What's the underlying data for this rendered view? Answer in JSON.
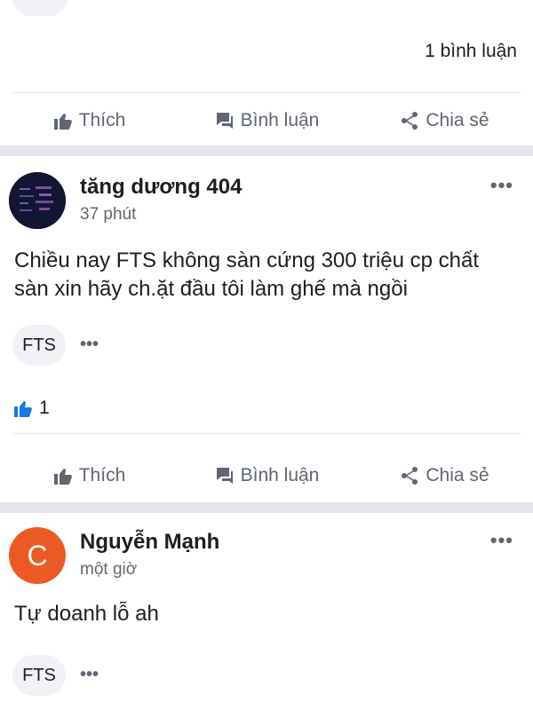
{
  "post1": {
    "comment_count": "1 bình luận"
  },
  "actions": {
    "like": "Thích",
    "comment": "Bình luận",
    "share": "Chia sẻ"
  },
  "post2": {
    "author": "tăng dương 404",
    "time": "37 phút",
    "text": "Chiều nay FTS không sàn cứng 300 triệu cp chất sàn xin hãy ch.ặt đầu tôi làm ghế mà ngồi",
    "tag": "FTS",
    "like_count": "1"
  },
  "post3": {
    "author": "Nguyễn Mạnh",
    "avatar_letter": "C",
    "time": "một giờ",
    "text": "Tự doanh lỗ ah",
    "tag": "FTS"
  },
  "more_label": "•••",
  "colors": {
    "accent": "#1877f2",
    "avatar_orange": "#ec5a24",
    "text_secondary": "#65676b",
    "separator": "#e4e6eb"
  },
  "icons": [
    "thumbs-up-icon",
    "comment-icon",
    "share-icon",
    "more-icon",
    "like-reaction-icon"
  ]
}
